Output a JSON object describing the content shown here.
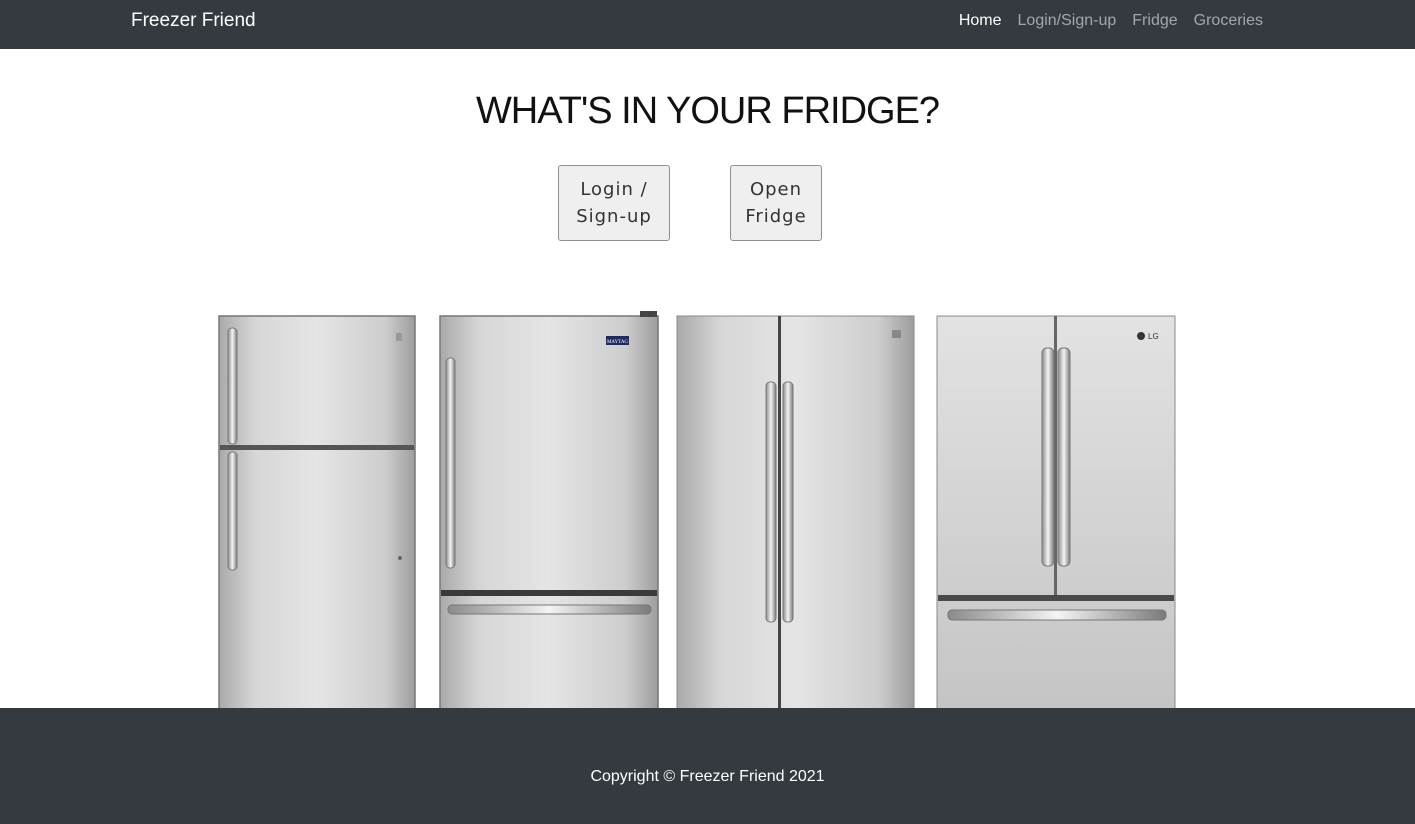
{
  "navbar": {
    "brand": "Freezer Friend",
    "links": [
      "Home",
      "Login/Sign-up",
      "Fridge",
      "Groceries"
    ],
    "active": "Home"
  },
  "hero": {
    "title": "WHAT'S IN YOUR FRIDGE?",
    "buttons": {
      "login": [
        "Login /",
        "Sign-up"
      ],
      "fridge": [
        "Open",
        "Fridge"
      ]
    }
  },
  "fridge_images": [
    {
      "name": "top-freezer-fridge"
    },
    {
      "name": "bottom-freezer-fridge",
      "badge": "MAYTAG"
    },
    {
      "name": "side-by-side-fridge"
    },
    {
      "name": "french-door-fridge",
      "badge": "LG"
    }
  ],
  "footer": {
    "copyright": "Copyright © Freezer Friend 2021"
  },
  "colors": {
    "dark": "#343a40",
    "nav_link": "rgba(255,255,255,.55)",
    "button_bg": "#efefef"
  }
}
